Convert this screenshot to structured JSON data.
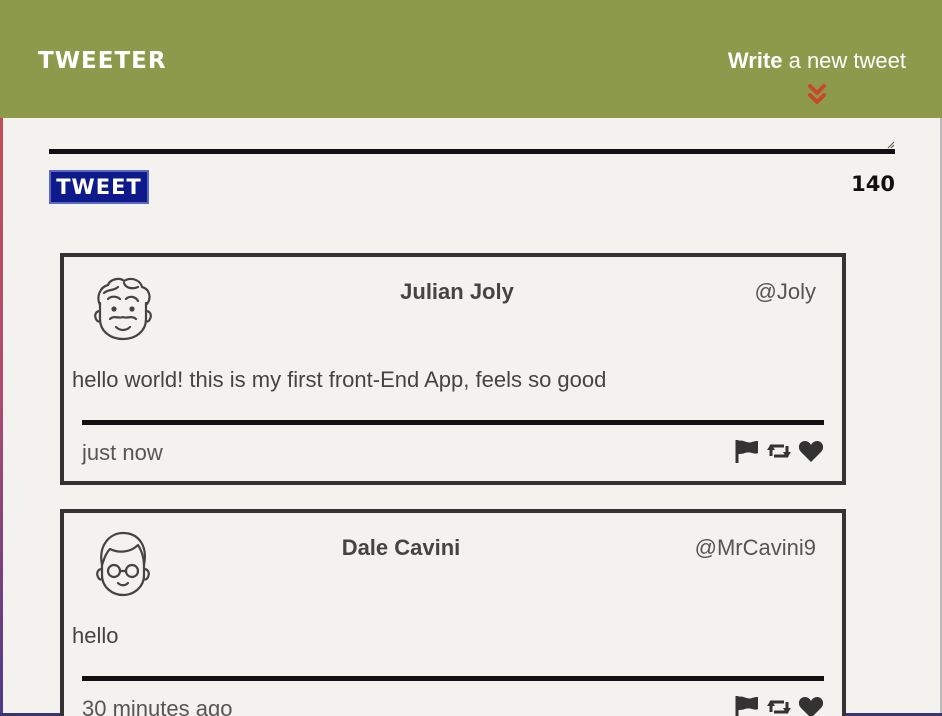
{
  "header": {
    "logo": "TWEETER",
    "compose_bold": "Write",
    "compose_rest": " a new tweet"
  },
  "composer": {
    "textarea_value": "",
    "button_label": "TWEET",
    "counter": "140"
  },
  "tweets": [
    {
      "name": "Julian Joly",
      "handle": "@Joly",
      "content": "hello world! this is my first front-End App, feels so good",
      "timestamp": "just now",
      "avatar": "curly-hair-avatar-icon"
    },
    {
      "name": "Dale Cavini",
      "handle": "@MrCavini9",
      "content": "hello",
      "timestamp": "30 minutes ago",
      "avatar": "glasses-avatar-icon"
    }
  ],
  "icons": {
    "action_flag": "flag-icon",
    "action_retweet": "retweet-icon",
    "action_like": "heart-icon",
    "chevron": "double-chevron-down-icon"
  },
  "colors": {
    "header_bg": "#8e9a4b",
    "page_bg": "#f4f2ee",
    "tweet_button": "#0e1a8c",
    "chevron": "#c8452e"
  }
}
